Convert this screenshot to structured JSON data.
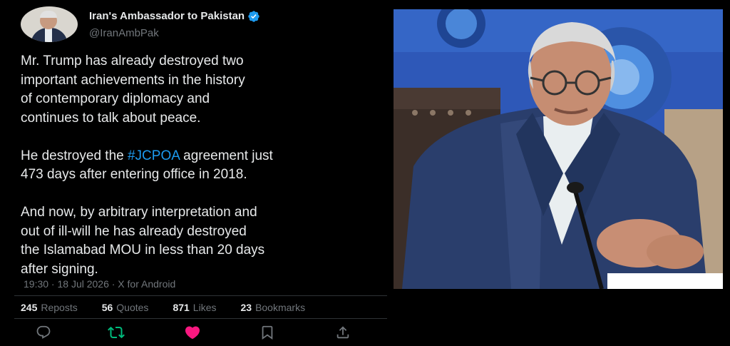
{
  "tweet": {
    "display_name": "Iran's Ambassador to Pakistan",
    "handle": "@IranAmbPak",
    "paragraphs": [
      {
        "lines": [
          "Mr. Trump has already destroyed two",
          "important achievements in the history",
          "of contemporary diplomacy and",
          "continues to talk about peace."
        ]
      },
      {
        "line1_before": "He destroyed the ",
        "hashtag": "#JCPOA",
        "line1_after": " agreement just",
        "line2": "473 days after entering office in 2018."
      },
      {
        "lines": [
          "And now, by arbitrary interpretation and",
          "out of ill-will he has already destroyed",
          "the Islamabad MOU in less than 20 days",
          "after signing."
        ]
      }
    ],
    "meta": "19:30 · 18 Jul 2026 · X for Android",
    "stats": [
      {
        "count": "245",
        "label": "Reposts"
      },
      {
        "count": "56",
        "label": "Quotes"
      },
      {
        "count": "871",
        "label": "Likes"
      },
      {
        "count": "23",
        "label": "Bookmarks"
      }
    ],
    "actions": {
      "reply": "reply-icon",
      "retweet": "retweet-icon",
      "like": "heart-icon",
      "bookmark": "bookmark-icon",
      "share": "share-icon"
    }
  },
  "colors": {
    "background": "#000000",
    "text": "#e7e9ea",
    "muted": "#71767b",
    "link": "#1d9bf0",
    "verified": "#1d9bf0",
    "retweet_active": "#00ba7c",
    "like_active": "#f91880"
  }
}
